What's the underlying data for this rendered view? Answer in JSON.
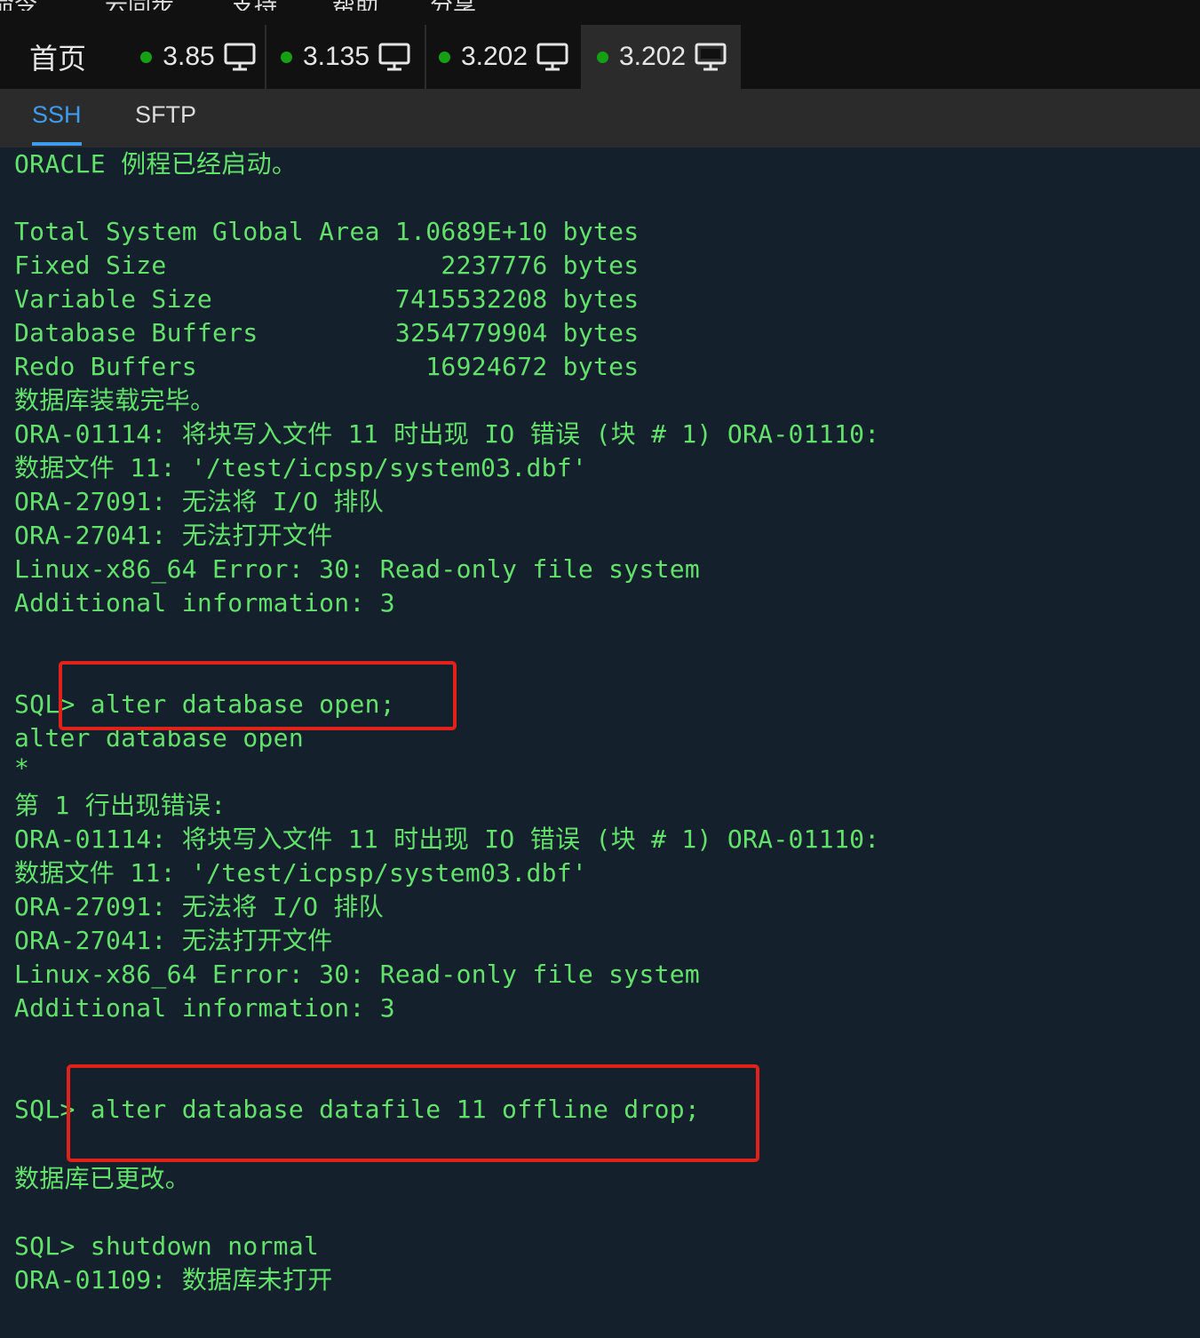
{
  "menu": {
    "items": [
      "命令",
      "云同步",
      "支持",
      "帮助",
      "分享"
    ]
  },
  "tabs": {
    "home": "首页",
    "hosts": [
      {
        "label": "3.85",
        "status_color": "#14a214"
      },
      {
        "label": "3.135",
        "status_color": "#14a214"
      },
      {
        "label": "3.202",
        "status_color": "#14a214"
      },
      {
        "label": "3.202",
        "status_color": "#14a214",
        "active": true
      }
    ]
  },
  "subtabs": [
    "SSH",
    "SFTP"
  ],
  "terminal": {
    "lines": [
      "ORACLE 例程已经启动。",
      "",
      "Total System Global Area 1.0689E+10 bytes",
      "Fixed Size                  2237776 bytes",
      "Variable Size            7415532208 bytes",
      "Database Buffers         3254779904 bytes",
      "Redo Buffers               16924672 bytes",
      "数据库装载完毕。",
      "ORA-01114: 将块写入文件 11 时出现 IO 错误 (块 # 1) ORA-01110:",
      "数据文件 11: '/test/icpsp/system03.dbf'",
      "ORA-27091: 无法将 I/O 排队",
      "ORA-27041: 无法打开文件",
      "Linux-x86_64 Error: 30: Read-only file system",
      "Additional information: 3",
      "",
      "",
      "SQL> alter database open;",
      "alter database open",
      "*",
      "第 1 行出现错误:",
      "ORA-01114: 将块写入文件 11 时出现 IO 错误 (块 # 1) ORA-01110:",
      "数据文件 11: '/test/icpsp/system03.dbf'",
      "ORA-27091: 无法将 I/O 排队",
      "ORA-27041: 无法打开文件",
      "Linux-x86_64 Error: 30: Read-only file system",
      "Additional information: 3",
      "",
      "",
      "SQL> alter database datafile 11 offline drop;",
      "",
      "数据库已更改。",
      "",
      "SQL> shutdown normal",
      "ORA-01109: 数据库未打开"
    ]
  },
  "colors": {
    "terminal_bg": "#15202d",
    "terminal_text": "#63e26b",
    "highlight_box": "#e3211b",
    "accent": "#3d9cf0"
  }
}
